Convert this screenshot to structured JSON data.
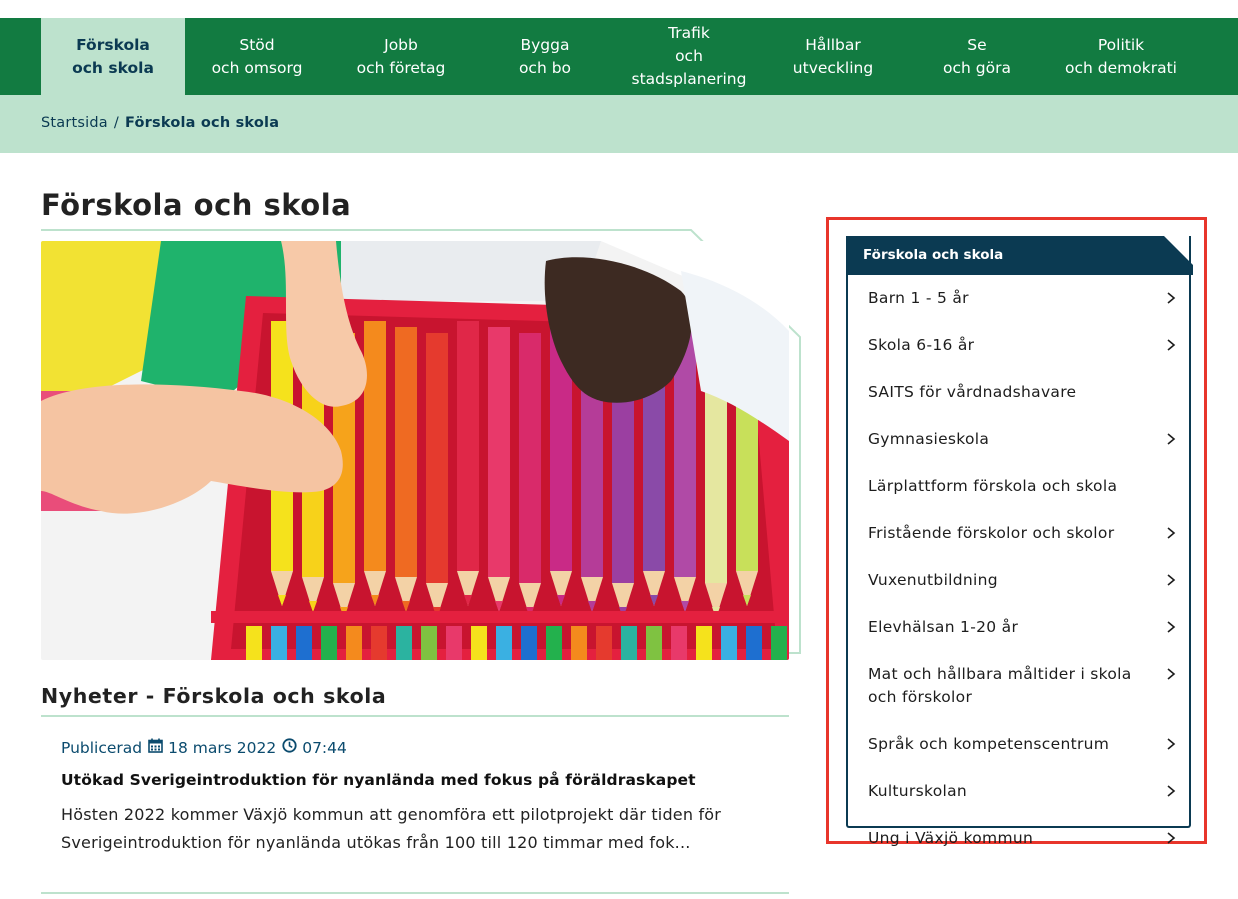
{
  "nav": {
    "items": [
      {
        "label": "Förskola\noch skola",
        "active": true
      },
      {
        "label": "Stöd\noch omsorg",
        "active": false
      },
      {
        "label": "Jobb\noch företag",
        "active": false
      },
      {
        "label": "Bygga\noch bo",
        "active": false
      },
      {
        "label": "Trafik\noch\nstadsplanering",
        "active": false
      },
      {
        "label": "Hållbar\nutveckling",
        "active": false
      },
      {
        "label": "Se\noch göra",
        "active": false
      },
      {
        "label": "Politik\noch demokrati",
        "active": false
      }
    ]
  },
  "breadcrumb": {
    "home": "Startsida",
    "separator": "/",
    "current": "Förskola och skola"
  },
  "page": {
    "title": "Förskola och skola"
  },
  "news": {
    "heading": "Nyheter - Förskola och skola",
    "published_label": "Publicerad",
    "date": "18 mars 2022",
    "time": "07:44",
    "title": "Utökad Sverigeintroduktion för nyanlända med fokus på föräldraskapet",
    "excerpt": "Hösten 2022 kommer Växjö kommun att genomföra ett pilotprojekt där tiden för Sverigeintroduktion för nyanlända utökas från 100 till 120 timmar med fok..."
  },
  "sidemenu": {
    "title": "Förskola och skola",
    "items": [
      {
        "label": "Barn 1 - 5 år",
        "has_children": true
      },
      {
        "label": "Skola 6-16 år",
        "has_children": true
      },
      {
        "label": "SAITS för vårdnadshavare",
        "has_children": false
      },
      {
        "label": "Gymnasieskola",
        "has_children": true
      },
      {
        "label": "Lärplattform förskola och skola",
        "has_children": false
      },
      {
        "label": "Fristående förskolor och skolor",
        "has_children": true
      },
      {
        "label": "Vuxenutbildning",
        "has_children": true
      },
      {
        "label": "Elevhälsan 1-20 år",
        "has_children": true
      },
      {
        "label": "Mat och hållbara måltider i skola och förskolor",
        "has_children": true
      },
      {
        "label": "Språk och kompetenscentrum",
        "has_children": true
      },
      {
        "label": "Kulturskolan",
        "has_children": true
      },
      {
        "label": "Ung i Växjö kommun",
        "has_children": true
      }
    ]
  },
  "colors": {
    "nav_green": "#127b41",
    "light_green": "#bde2cd",
    "navy": "#0b3a52",
    "highlight_red": "#e8352b"
  }
}
